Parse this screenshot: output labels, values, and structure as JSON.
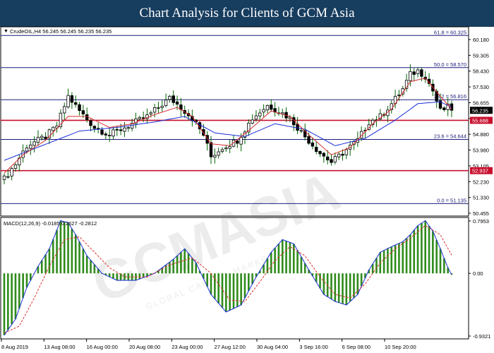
{
  "header": {
    "title": "Chart Analysis for Clients of GCM Asia"
  },
  "watermark": {
    "text": "GCMASIA",
    "subtext": "GLOBAL CAPITAL MARKETS"
  },
  "colors": {
    "header_bg": "#173d5f",
    "fib_line": "#1c1c7a",
    "sr_line": "#c8102e",
    "candle": "#000000",
    "candle_wick": "#006400",
    "ma_fast": "#d62f2f",
    "ma_slow": "#1a2fd6",
    "macd_hist": "#2e8b1a",
    "macd_line": "#1a2fd6",
    "macd_signal": "#e22c2c"
  },
  "chart_data": [
    {
      "type": "candlestick",
      "title": "CrudeOIL,H4  56.245 56.245 56.235 56.235",
      "ylim": [
        50.455,
        60.8
      ],
      "y_ticks": [
        "60.180",
        "59.305",
        "58.430",
        "57.530",
        "56.655",
        "55.780",
        "54.880",
        "53.980",
        "53.105",
        "52.230",
        "51.330",
        "50.455"
      ],
      "x_ticks": [
        "8 Aug 2019",
        "13 Aug 08:00",
        "16 Aug 00:00",
        "20 Aug 08:00",
        "23 Aug 00:00",
        "27 Aug 12:00",
        "30 Aug 04:00",
        "3 Sep 16:00",
        "6 Sep 08:00",
        "10 Sep 20:00"
      ],
      "fibonacci_levels": [
        {
          "label": "61.8 = 60.325",
          "value": 60.325
        },
        {
          "label": "50.0 = 58.570",
          "value": 58.57
        },
        {
          "label": "38.2 = 56.816",
          "value": 56.816
        },
        {
          "label": "23.6 = 54.644",
          "value": 54.644
        },
        {
          "label": "0.0 = 51.135",
          "value": 51.135
        }
      ],
      "support_resistance": [
        {
          "label": "55.688",
          "value": 55.688
        },
        {
          "label": "52.937",
          "value": 52.937
        }
      ],
      "current_price": {
        "label": "56.235",
        "value": 56.235
      },
      "close_path": [
        [
          0,
          52.5
        ],
        [
          3,
          53.3
        ],
        [
          6,
          54.3
        ],
        [
          11,
          54.8
        ],
        [
          14,
          55.4
        ],
        [
          17,
          57.0
        ],
        [
          20,
          56.2
        ],
        [
          24,
          55.3
        ],
        [
          28,
          54.9
        ],
        [
          33,
          55.4
        ],
        [
          38,
          55.9
        ],
        [
          41,
          56.4
        ],
        [
          44,
          56.9
        ],
        [
          47,
          56.4
        ],
        [
          50,
          55.8
        ],
        [
          53,
          54.9
        ],
        [
          55,
          53.7
        ],
        [
          58,
          54.2
        ],
        [
          62,
          54.6
        ],
        [
          66,
          55.8
        ],
        [
          70,
          56.5
        ],
        [
          73,
          56.2
        ],
        [
          76,
          55.8
        ],
        [
          80,
          54.8
        ],
        [
          84,
          53.9
        ],
        [
          87,
          53.4
        ],
        [
          90,
          53.9
        ],
        [
          94,
          54.6
        ],
        [
          97,
          55.6
        ],
        [
          100,
          55.9
        ],
        [
          103,
          56.6
        ],
        [
          106,
          57.4
        ],
        [
          108,
          58.2
        ],
        [
          110,
          58.4
        ],
        [
          112,
          58.1
        ],
        [
          114,
          57.3
        ],
        [
          116,
          56.2
        ],
        [
          118,
          56.4
        ],
        [
          119,
          56.235
        ]
      ],
      "ma_fast_path": [
        [
          0,
          52.8
        ],
        [
          5,
          53.8
        ],
        [
          11,
          54.6
        ],
        [
          17,
          55.9
        ],
        [
          22,
          55.9
        ],
        [
          28,
          55.3
        ],
        [
          34,
          55.5
        ],
        [
          40,
          56.0
        ],
        [
          46,
          56.4
        ],
        [
          50,
          55.9
        ],
        [
          55,
          54.4
        ],
        [
          60,
          54.3
        ],
        [
          66,
          55.3
        ],
        [
          71,
          56.2
        ],
        [
          76,
          55.9
        ],
        [
          81,
          54.9
        ],
        [
          87,
          53.8
        ],
        [
          92,
          54.2
        ],
        [
          98,
          55.5
        ],
        [
          103,
          56.3
        ],
        [
          108,
          57.8
        ],
        [
          112,
          58.0
        ],
        [
          116,
          57.0
        ],
        [
          119,
          56.3
        ]
      ],
      "ma_slow_path": [
        [
          0,
          53.5
        ],
        [
          10,
          54.3
        ],
        [
          20,
          55.1
        ],
        [
          30,
          55.3
        ],
        [
          40,
          55.6
        ],
        [
          48,
          55.9
        ],
        [
          56,
          55.0
        ],
        [
          64,
          54.8
        ],
        [
          72,
          55.5
        ],
        [
          80,
          55.2
        ],
        [
          88,
          54.3
        ],
        [
          96,
          54.7
        ],
        [
          104,
          55.7
        ],
        [
          110,
          56.6
        ],
        [
          116,
          56.7
        ],
        [
          119,
          56.4
        ]
      ],
      "n_bars": 120,
      "grid": false
    },
    {
      "type": "macd",
      "title": "MACD(12,26,9) -0.0185 0.2627 -0.2812",
      "ylim": [
        -0.9321,
        0.7953
      ],
      "y_ticks": [
        "0.7953",
        "0.00",
        "-0.9321"
      ],
      "macd_path": [
        [
          0,
          -0.88
        ],
        [
          3,
          -0.65
        ],
        [
          6,
          -0.2
        ],
        [
          9,
          0.1
        ],
        [
          12,
          0.35
        ],
        [
          15,
          0.75
        ],
        [
          17,
          0.72
        ],
        [
          19,
          0.55
        ],
        [
          22,
          0.25
        ],
        [
          26,
          0.0
        ],
        [
          30,
          -0.1
        ],
        [
          35,
          -0.1
        ],
        [
          40,
          0.0
        ],
        [
          45,
          0.2
        ],
        [
          48,
          0.35
        ],
        [
          51,
          0.15
        ],
        [
          55,
          -0.3
        ],
        [
          59,
          -0.55
        ],
        [
          63,
          -0.45
        ],
        [
          67,
          -0.05
        ],
        [
          71,
          0.3
        ],
        [
          74,
          0.48
        ],
        [
          77,
          0.42
        ],
        [
          81,
          0.05
        ],
        [
          85,
          -0.3
        ],
        [
          88,
          -0.4
        ],
        [
          91,
          -0.45
        ],
        [
          94,
          -0.3
        ],
        [
          97,
          0.05
        ],
        [
          100,
          0.3
        ],
        [
          103,
          0.38
        ],
        [
          106,
          0.45
        ],
        [
          108,
          0.55
        ],
        [
          110,
          0.68
        ],
        [
          112,
          0.75
        ],
        [
          114,
          0.6
        ],
        [
          116,
          0.35
        ],
        [
          118,
          0.08
        ],
        [
          119,
          -0.02
        ]
      ],
      "signal_path": [
        [
          0,
          -0.85
        ],
        [
          4,
          -0.75
        ],
        [
          8,
          -0.35
        ],
        [
          12,
          0.1
        ],
        [
          16,
          0.48
        ],
        [
          20,
          0.52
        ],
        [
          24,
          0.3
        ],
        [
          28,
          0.08
        ],
        [
          32,
          -0.05
        ],
        [
          38,
          -0.05
        ],
        [
          44,
          0.12
        ],
        [
          50,
          0.22
        ],
        [
          55,
          0.0
        ],
        [
          60,
          -0.38
        ],
        [
          64,
          -0.4
        ],
        [
          68,
          -0.12
        ],
        [
          72,
          0.18
        ],
        [
          76,
          0.38
        ],
        [
          80,
          0.25
        ],
        [
          84,
          -0.05
        ],
        [
          88,
          -0.3
        ],
        [
          92,
          -0.35
        ],
        [
          96,
          -0.15
        ],
        [
          100,
          0.15
        ],
        [
          104,
          0.35
        ],
        [
          108,
          0.5
        ],
        [
          112,
          0.68
        ],
        [
          116,
          0.55
        ],
        [
          119,
          0.26
        ]
      ],
      "grid": false
    }
  ]
}
